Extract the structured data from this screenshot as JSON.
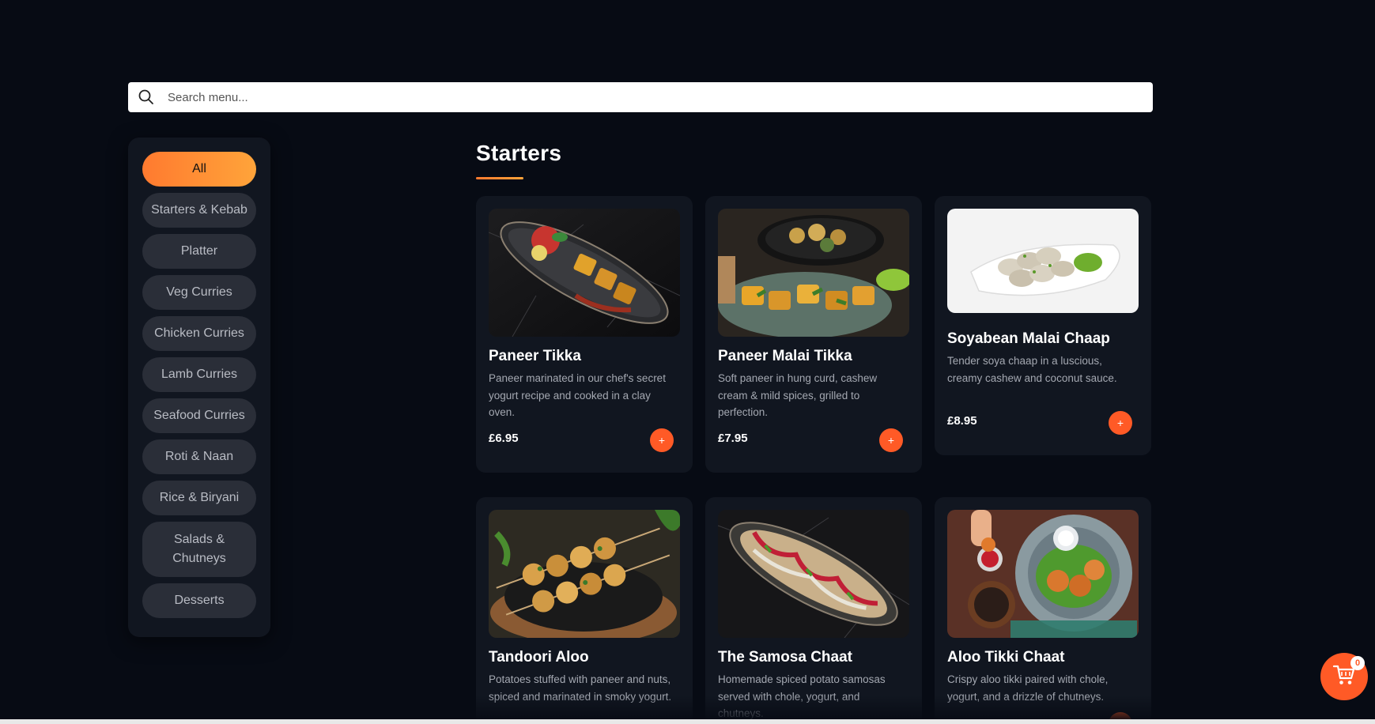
{
  "search": {
    "placeholder": "Search menu..."
  },
  "sidebar": {
    "categories": [
      {
        "label": "All",
        "active": true
      },
      {
        "label": "Starters & Kebab"
      },
      {
        "label": "Platter"
      },
      {
        "label": "Veg Curries"
      },
      {
        "label": "Chicken Curries"
      },
      {
        "label": "Lamb Curries"
      },
      {
        "label": "Seafood Curries"
      },
      {
        "label": "Roti & Naan"
      },
      {
        "label": "Rice & Biryani"
      },
      {
        "label": "Salads & Chutneys"
      },
      {
        "label": "Desserts"
      }
    ]
  },
  "main": {
    "section_title": "Starters",
    "items": [
      {
        "name": "Paneer Tikka",
        "description": "Paneer marinated in our chef's secret yogurt recipe and cooked in a clay oven.",
        "price": "£6.95",
        "image": "paneer-tikka-photo",
        "add": "+"
      },
      {
        "name": "Paneer Malai Tikka",
        "description": "Soft paneer in hung curd, cashew cream & mild spices, grilled to perfection.",
        "price": "£7.95",
        "image": "paneer-malai-tikka-photo",
        "add": "+"
      },
      {
        "name": "Soyabean Malai Chaap",
        "description": "Tender soya chaap in a luscious, creamy cashew and coconut sauce.",
        "price": "£8.95",
        "image": "soyabean-malai-chaap-photo",
        "add": "+"
      },
      {
        "name": "Tandoori Aloo",
        "description": "Potatoes stuffed with paneer and nuts, spiced and marinated in smoky yogurt.",
        "price": "",
        "image": "tandoori-aloo-photo",
        "add": "+"
      },
      {
        "name": "The Samosa Chaat",
        "description": "Homemade spiced potato samosas served with chole, yogurt, and chutneys.",
        "price": "",
        "image": "samosa-chaat-photo",
        "add": "+"
      },
      {
        "name": "Aloo Tikki Chaat",
        "description": "Crispy aloo tikki paired with chole, yogurt, and a drizzle of chutneys.",
        "price": "",
        "image": "aloo-tikki-chaat-photo",
        "add": "+"
      }
    ]
  },
  "cart": {
    "count": "0",
    "icon": "cart-icon"
  },
  "colors": {
    "accent": "#ff5a26",
    "accent_gradient_end": "#ffa43a",
    "background": "#070b14",
    "card": "#111620"
  }
}
